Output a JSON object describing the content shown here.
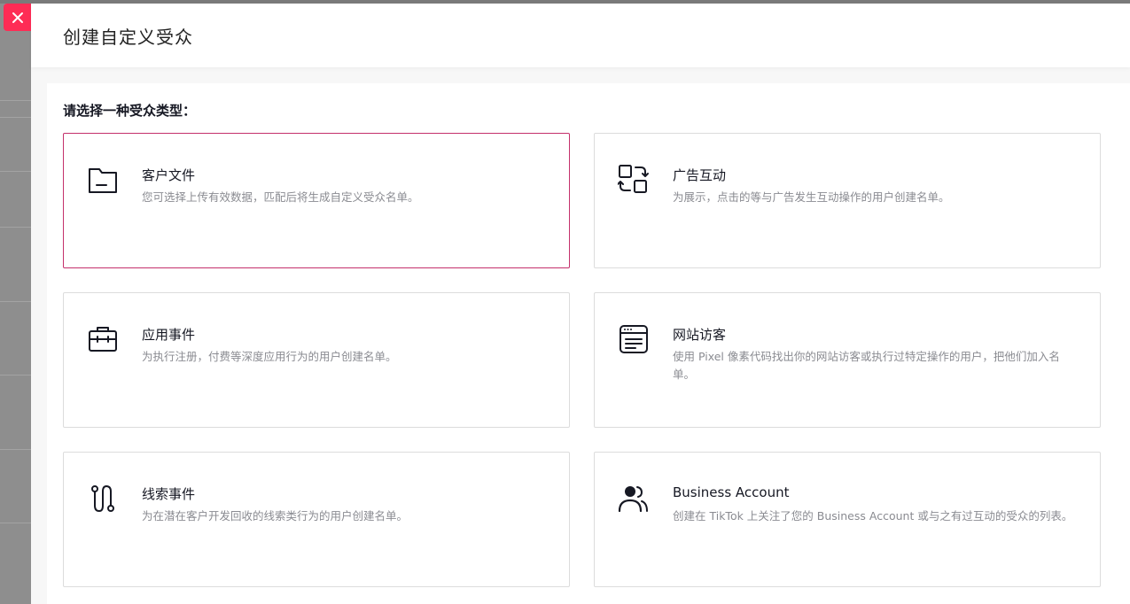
{
  "drawer": {
    "title": "创建自定义受众",
    "prompt": "请选择一种受众类型：",
    "close_icon": "close-icon"
  },
  "audience_types": [
    {
      "title": "客户文件",
      "desc": "您可选择上传有效数据，匹配后将生成自定义受众名单。",
      "icon": "folder-icon",
      "selected": true
    },
    {
      "title": "广告互动",
      "desc": "为展示，点击的等与广告发生互动操作的用户创建名单。",
      "icon": "engagement-icon",
      "selected": false
    },
    {
      "title": "应用事件",
      "desc": "为执行注册，付费等深度应用行为的用户创建名单。",
      "icon": "briefcase-icon",
      "selected": false
    },
    {
      "title": "网站访客",
      "desc": "使用 Pixel 像素代码找出你的网站访客或执行过特定操作的用户，把他们加入名单。",
      "icon": "browser-window-icon",
      "selected": false
    },
    {
      "title": "线索事件",
      "desc": "为在潜在客户开发回收的线索类行为的用户创建名单。",
      "icon": "route-icon",
      "selected": false
    },
    {
      "title": "Business Account",
      "desc": "创建在 TikTok 上关注了您的 Business Account 或与之有过互动的受众的列表。",
      "icon": "users-icon",
      "selected": false
    }
  ],
  "colors": {
    "accent": "#fe2c55",
    "selected_border": "#c4306b"
  }
}
